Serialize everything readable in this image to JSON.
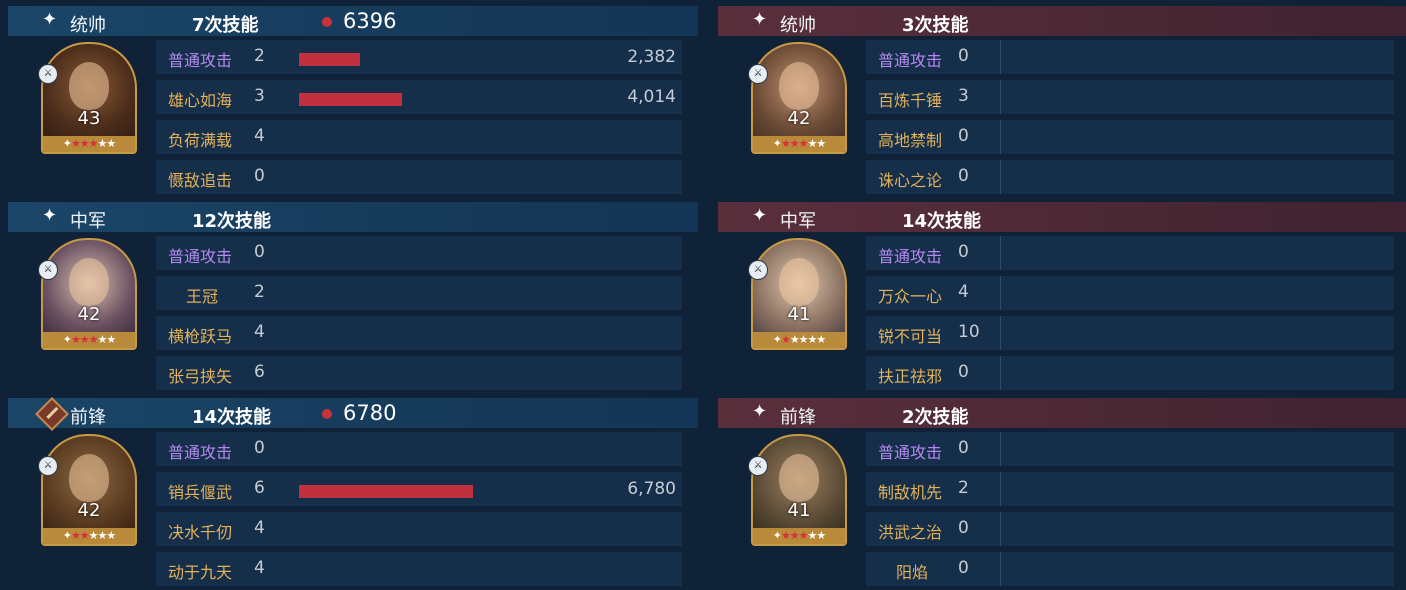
{
  "left": [
    {
      "role": "统帅",
      "skill_count": "7次技能",
      "damage": "6396",
      "level": "43",
      "stars_on": 3,
      "stars_total": 5,
      "badge_type": "star",
      "skills": [
        {
          "name": "普通攻击",
          "count": "2",
          "basic": true,
          "bar_fraction": 0.353,
          "value": "2,382"
        },
        {
          "name": "雄心如海",
          "count": "3",
          "basic": false,
          "bar_fraction": 0.592,
          "value": "4,014"
        },
        {
          "name": "负荷满载",
          "count": "4",
          "basic": false
        },
        {
          "name": "慑敌追击",
          "count": "0",
          "basic": false
        }
      ]
    },
    {
      "role": "中军",
      "skill_count": "12次技能",
      "damage": "",
      "level": "42",
      "stars_on": 3,
      "stars_total": 5,
      "badge_type": "star",
      "skills": [
        {
          "name": "普通攻击",
          "count": "0",
          "basic": true
        },
        {
          "name": "王冠",
          "count": "2",
          "basic": false,
          "center": true
        },
        {
          "name": "横枪跃马",
          "count": "4",
          "basic": false
        },
        {
          "name": "张弓挟矢",
          "count": "6",
          "basic": false
        }
      ]
    },
    {
      "role": "前锋",
      "skill_count": "14次技能",
      "damage": "6780",
      "level": "42",
      "stars_on": 2,
      "stars_total": 5,
      "badge_type": "sword",
      "skills": [
        {
          "name": "普通攻击",
          "count": "0",
          "basic": true
        },
        {
          "name": "销兵偃武",
          "count": "6",
          "basic": false,
          "bar_fraction": 1.0,
          "value": "6,780"
        },
        {
          "name": "决水千仞",
          "count": "4",
          "basic": false
        },
        {
          "name": "动于九天",
          "count": "4",
          "basic": false
        }
      ]
    }
  ],
  "right": [
    {
      "role": "统帅",
      "skill_count": "3次技能",
      "level": "42",
      "stars_on": 3,
      "stars_total": 5,
      "skills": [
        {
          "name": "普通攻击",
          "count": "0",
          "basic": true
        },
        {
          "name": "百炼千锤",
          "count": "3",
          "basic": false
        },
        {
          "name": "高地禁制",
          "count": "0",
          "basic": false
        },
        {
          "name": "诛心之论",
          "count": "0",
          "basic": false
        }
      ]
    },
    {
      "role": "中军",
      "skill_count": "14次技能",
      "level": "41",
      "stars_on": 1,
      "stars_total": 5,
      "skills": [
        {
          "name": "普通攻击",
          "count": "0",
          "basic": true
        },
        {
          "name": "万众一心",
          "count": "4",
          "basic": false
        },
        {
          "name": "锐不可当",
          "count": "10",
          "basic": false
        },
        {
          "name": "扶正祛邪",
          "count": "0",
          "basic": false
        }
      ]
    },
    {
      "role": "前锋",
      "skill_count": "2次技能",
      "level": "41",
      "stars_on": 3,
      "stars_total": 5,
      "skills": [
        {
          "name": "普通攻击",
          "count": "0",
          "basic": true
        },
        {
          "name": "制敌机先",
          "count": "2",
          "basic": false
        },
        {
          "name": "洪武之治",
          "count": "0",
          "basic": false
        },
        {
          "name": "阳焰",
          "count": "0",
          "basic": false,
          "center": true
        }
      ]
    }
  ],
  "colors": {
    "basic_skill": "#b48af0",
    "skill": "#e3b25a",
    "damage_bar": "#c0303e",
    "ally_header": "#1a4668",
    "enemy_header": "#5a2f3c"
  },
  "icons": {
    "header_marker": "spark-icon",
    "vanguard_marker": "sword-badge-icon",
    "troop_type": "troop-type-icon",
    "star": "star-icon"
  }
}
